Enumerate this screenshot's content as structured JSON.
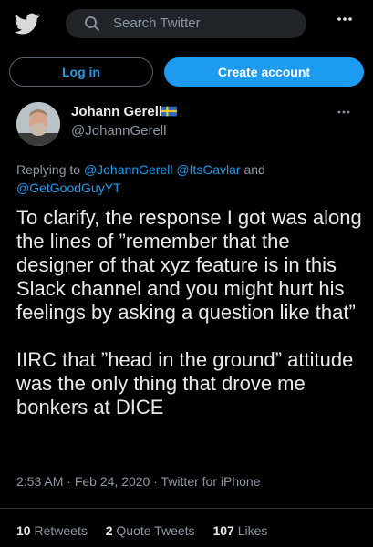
{
  "header": {
    "logo_icon": "twitter-bird-icon",
    "search_placeholder": "Search Twitter",
    "more_icon": "more-horizontal-icon"
  },
  "auth": {
    "login_label": "Log in",
    "create_label": "Create account"
  },
  "author": {
    "name": "Johann Gerell",
    "flag_icon": "sweden-flag-icon",
    "handle": "@JohannGerell"
  },
  "reply": {
    "prefix": "Replying to",
    "mention1": "@JohannGerell",
    "mention2": "@ItsGavlar",
    "and": "and",
    "mention3": "@GetGoodGuyYT"
  },
  "tweet": {
    "paragraph1": "To clarify, the response I got was along the lines of ”remember that the designer of that xyz feature is in this Slack channel and you might hurt his feelings by asking a question like that”",
    "paragraph2": "IIRC that ”head in the ground” attitude was the only thing that drove me bonkers at DICE"
  },
  "meta": {
    "time": "2:53 AM",
    "date": "Feb 24, 2020",
    "source": "Twitter for iPhone",
    "dot": "·"
  },
  "stats": {
    "retweets_count": "10",
    "retweets_label": "Retweets",
    "quotes_count": "2",
    "quotes_label": "Quote Tweets",
    "likes_count": "107",
    "likes_label": "Likes"
  },
  "colors": {
    "accent": "#1d9bf0",
    "background": "#000000",
    "secondary_text": "#8b98a5"
  }
}
